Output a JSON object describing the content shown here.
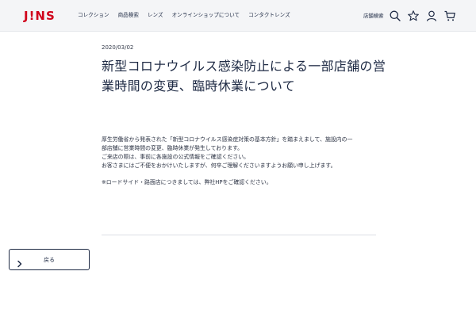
{
  "header": {
    "logo_text": "J!NS",
    "nav": [
      {
        "label": "コレクション"
      },
      {
        "label": "商品検索"
      },
      {
        "label": "レンズ"
      },
      {
        "label": "オンラインショップについて"
      },
      {
        "label": "コンタクトレンズ"
      }
    ],
    "store_search_label": "店舗検索"
  },
  "article": {
    "date": "2020/03/02",
    "title": "新型コロナウイルス感染防止による一部店舗の営業時間の変更、臨時休業について",
    "paragraphs": [
      "厚生労働省から発表された「新型コロナウイルス感染症対策の基本方針」を踏まえまして、施設内の一",
      "部店舗に営業時間の変更、臨時休業が発生しております。",
      "ご来店の際は、事前に各施設の公式情報をご確認ください。",
      "お客さまにはご不便をおかけいたしますが、何卒ご理解くださいますようお願い申し上げます。"
    ],
    "note": "※ロードサイド・路面店につきましては、弊社HPをご確認ください。"
  },
  "back_button": {
    "label": "戻る"
  },
  "colors": {
    "brand": "#d0021b",
    "text": "#1e2a44"
  }
}
